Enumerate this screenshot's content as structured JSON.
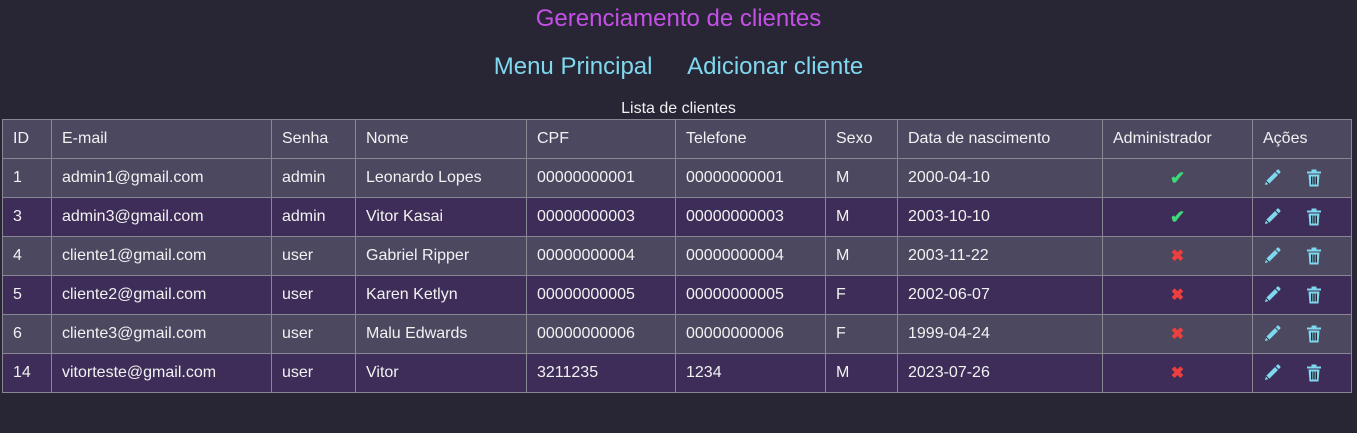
{
  "header": {
    "title": "Gerenciamento de clientes",
    "nav": [
      "Menu Principal",
      "Adicionar cliente"
    ]
  },
  "table": {
    "caption": "Lista de clientes",
    "columns": [
      "ID",
      "E-mail",
      "Senha",
      "Nome",
      "CPF",
      "Telefone",
      "Sexo",
      "Data de nascimento",
      "Administrador",
      "Ações"
    ],
    "rows": [
      {
        "id": "1",
        "email": "admin1@gmail.com",
        "senha": "admin",
        "nome": "Leonardo Lopes",
        "cpf": "00000000001",
        "telefone": "00000000001",
        "sexo": "M",
        "nascimento": "2000-04-10",
        "admin": true
      },
      {
        "id": "3",
        "email": "admin3@gmail.com",
        "senha": "admin",
        "nome": "Vitor Kasai",
        "cpf": "00000000003",
        "telefone": "00000000003",
        "sexo": "M",
        "nascimento": "2003-10-10",
        "admin": true
      },
      {
        "id": "4",
        "email": "cliente1@gmail.com",
        "senha": "user",
        "nome": "Gabriel Ripper",
        "cpf": "00000000004",
        "telefone": "00000000004",
        "sexo": "M",
        "nascimento": "2003-11-22",
        "admin": false
      },
      {
        "id": "5",
        "email": "cliente2@gmail.com",
        "senha": "user",
        "nome": "Karen Ketlyn",
        "cpf": "00000000005",
        "telefone": "00000000005",
        "sexo": "F",
        "nascimento": "2002-06-07",
        "admin": false
      },
      {
        "id": "6",
        "email": "cliente3@gmail.com",
        "senha": "user",
        "nome": "Malu Edwards",
        "cpf": "00000000006",
        "telefone": "00000000006",
        "sexo": "F",
        "nascimento": "1999-04-24",
        "admin": false
      },
      {
        "id": "14",
        "email": "vitorteste@gmail.com",
        "senha": "user",
        "nome": "Vitor",
        "cpf": "3211235",
        "telefone": "1234",
        "sexo": "M",
        "nascimento": "2023-07-26",
        "admin": false
      }
    ]
  },
  "icons": {
    "admin_true": "check-icon",
    "admin_false": "cross-icon",
    "edit": "pencil-icon",
    "delete": "trash-icon"
  },
  "colors": {
    "background": "#282634",
    "title": "#c64fe8",
    "link": "#7fd8ee",
    "check": "#3fd97a",
    "cross": "#ec4040",
    "row_odd": "#4c4860",
    "row_even": "#3e2d58"
  }
}
